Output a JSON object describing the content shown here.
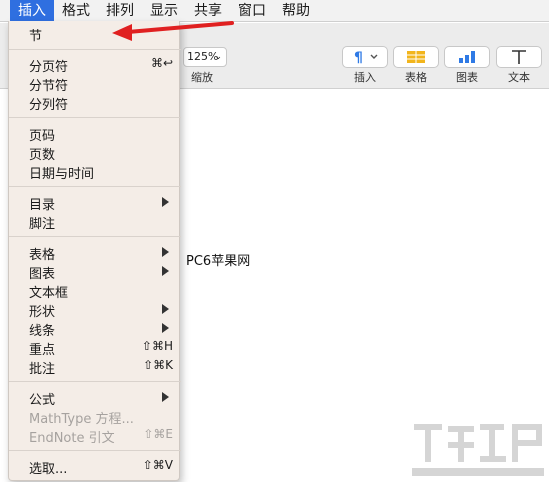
{
  "menubar": {
    "items": [
      "插入",
      "格式",
      "排列",
      "显示",
      "共享",
      "窗口",
      "帮助"
    ]
  },
  "toolbar": {
    "zoom_value": "125%",
    "zoom_label": "缩放",
    "buttons": [
      {
        "label": "插入",
        "icon": "paragraph-icon"
      },
      {
        "label": "表格",
        "icon": "table-icon"
      },
      {
        "label": "图表",
        "icon": "chart-icon"
      },
      {
        "label": "文本",
        "icon": "text-icon"
      }
    ]
  },
  "document": {
    "text": "PC6苹果网"
  },
  "menu": {
    "items": [
      {
        "label": "节"
      },
      {
        "label": "分页符",
        "shortcut": "⌘↩"
      },
      {
        "label": "分节符"
      },
      {
        "label": "分列符"
      },
      {
        "label": "页码"
      },
      {
        "label": "页数"
      },
      {
        "label": "日期与时间"
      },
      {
        "label": "目录"
      },
      {
        "label": "脚注"
      },
      {
        "label": "表格"
      },
      {
        "label": "图表"
      },
      {
        "label": "文本框"
      },
      {
        "label": "形状"
      },
      {
        "label": "线条"
      },
      {
        "label": "重点",
        "shortcut": "⇧⌘H"
      },
      {
        "label": "批注",
        "shortcut": "⇧⌘K"
      },
      {
        "label": "公式"
      },
      {
        "label": "MathType 方程..."
      },
      {
        "label": "EndNote 引文",
        "shortcut": "⇧⌘E"
      },
      {
        "label": "选取...",
        "shortcut": "⇧⌘V"
      }
    ]
  },
  "colors": {
    "menubar_active": "#2f6fe0",
    "annotation_arrow": "#e02020",
    "menu_background": "#f4ede7"
  }
}
